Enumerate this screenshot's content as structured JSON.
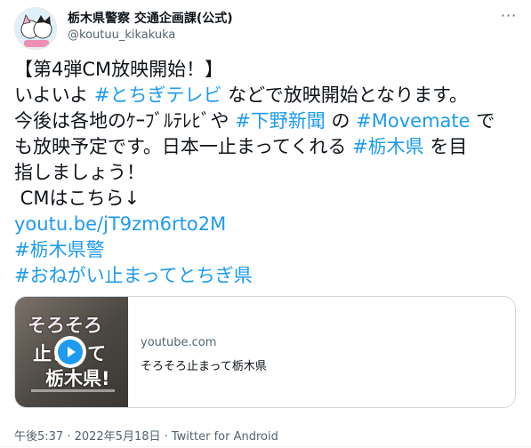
{
  "header": {
    "display_name": "栃木県警察 交通企画課(公式)",
    "handle": "@koutuu_kikakuka",
    "more_icon": "more-dots-icon"
  },
  "tweet": {
    "line1": "【第4弾CM放映開始！】",
    "line2_pre": "いよいよ ",
    "line2_link": "#とちぎテレビ",
    "line2_post": " などで放映開始となります。",
    "line3_pre": "今後は各地のｹｰﾌﾞﾙﾃﾚﾋﾞや ",
    "line3_link1": "#下野新聞",
    "line3_mid": " の ",
    "line3_link2": "#Movemate",
    "line3_post": " で",
    "line4_pre": "も放映予定です。日本一止まってくれる ",
    "line4_link": "#栃木県",
    "line4_post": " を目",
    "line5": "指しましょう！",
    "line6": " CMはこちら↓",
    "url": "youtu.be/jT9zm6rto2M",
    "tag1": "#栃木県警",
    "tag2": "#おねがい止まってとちぎ県"
  },
  "card": {
    "domain": "youtube.com",
    "title": "そろそろ止まって栃木県",
    "thumb_text1": "そろそろ",
    "thumb_text2": "止まって",
    "thumb_text3": "栃木県!",
    "play_icon": "play-icon"
  },
  "meta": {
    "timestamp": "午後5:37 · 2022年5月18日 · Twitter for Android"
  },
  "colors": {
    "link": "#1d9bf0",
    "muted": "#536471",
    "text": "#0f1419"
  }
}
